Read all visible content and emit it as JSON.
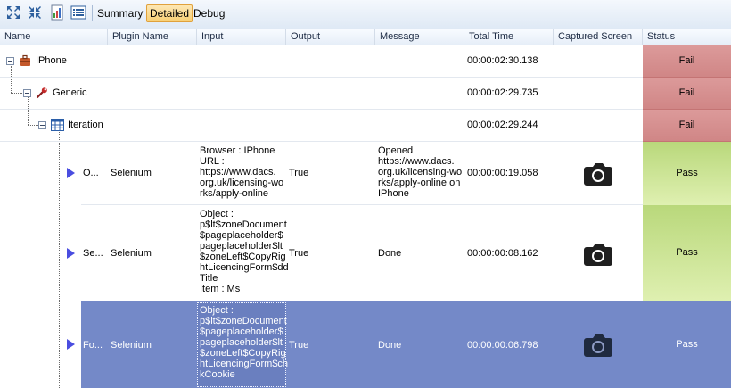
{
  "toolbar": {
    "summary_label": "Summary",
    "detailed_label": "Detailed",
    "debug_label": "Debug"
  },
  "columns": [
    "Name",
    "Plugin Name",
    "Input",
    "Output",
    "Message",
    "Total Time",
    "Captured Screen",
    "Status"
  ],
  "rows": {
    "iphone": {
      "name": "IPhone",
      "time": "00:00:02:30.138",
      "status": "Fail"
    },
    "generic": {
      "name": "Generic",
      "time": "00:00:02:29.735",
      "status": "Fail"
    },
    "iteration": {
      "name": "Iteration",
      "time": "00:00:02:29.244",
      "status": "Fail"
    },
    "step1": {
      "name": "O...",
      "plugin": "Selenium",
      "input": "Browser : IPhone\nURL :\nhttps://www.dacs.\norg.uk/licensing-wo\nrks/apply-online",
      "output": "True",
      "message": "Opened\nhttps://www.dacs.\norg.uk/licensing-wo\nrks/apply-online on\nIPhone",
      "time": "00:00:00:19.058",
      "status": "Pass"
    },
    "step2": {
      "name": "Se...",
      "plugin": "Selenium",
      "input": "Object :\np$lt$zoneDocument\n$pageplaceholder$\npageplaceholder$lt\n$zoneLeft$CopyRig\nhtLicencingForm$dd\nTitle\nItem : Ms",
      "output": "True",
      "message": "Done",
      "time": "00:00:00:08.162",
      "status": "Pass"
    },
    "step3": {
      "name": "Fo...",
      "plugin": "Selenium",
      "input": "Object :\np$lt$zoneDocument\n$pageplaceholder$\npageplaceholder$lt\n$zoneLeft$CopyRig\nhtLicencingForm$ch\nkCookie",
      "output": "True",
      "message": "Done",
      "time": "00:00:00:06.798",
      "status": "Pass"
    }
  },
  "colors": {
    "fail": "#d08686",
    "pass": "#c9e28f",
    "selected": "#7489c8",
    "arrow": "#4a4de0"
  }
}
